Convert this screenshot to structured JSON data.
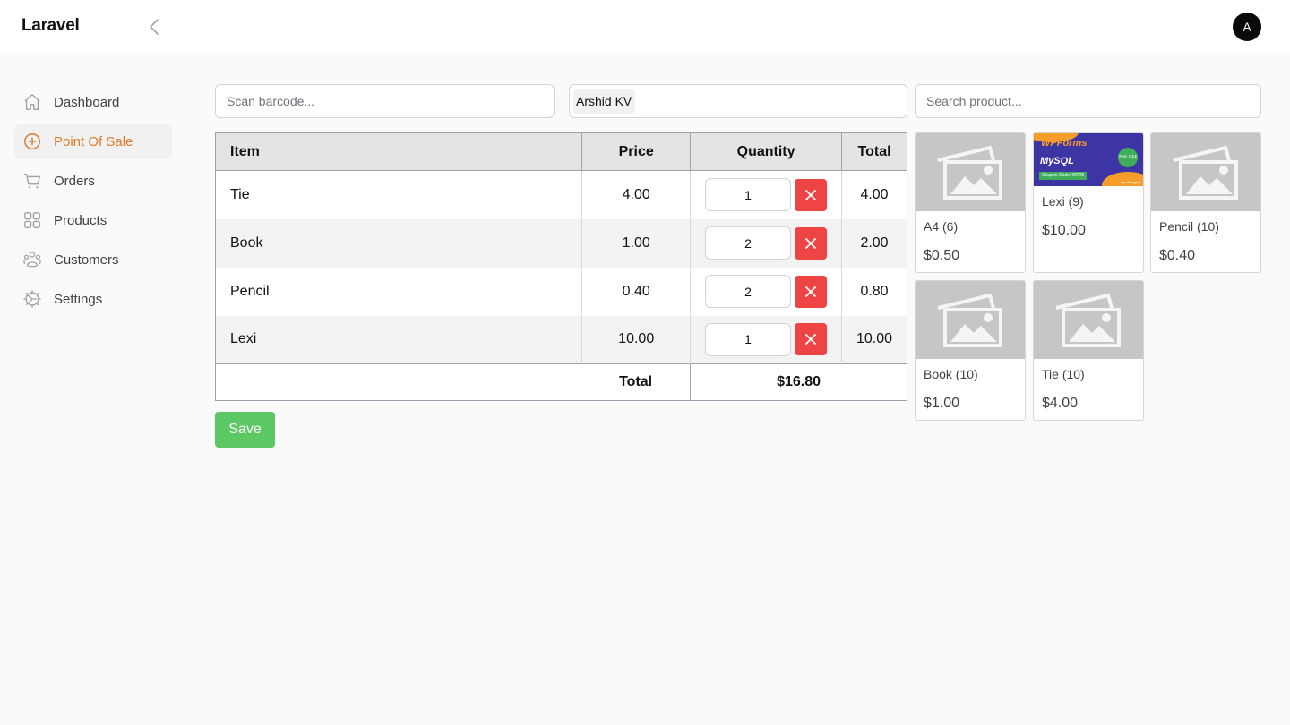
{
  "app": {
    "brand": "Laravel",
    "avatar_initial": "A"
  },
  "sidebar": {
    "items": [
      {
        "label": "Dashboard",
        "icon": "home-icon",
        "active": false
      },
      {
        "label": "Point Of Sale",
        "icon": "plus-circle-icon",
        "active": true
      },
      {
        "label": "Orders",
        "icon": "cart-icon",
        "active": false
      },
      {
        "label": "Products",
        "icon": "grid-icon",
        "active": false
      },
      {
        "label": "Customers",
        "icon": "users-icon",
        "active": false
      },
      {
        "label": "Settings",
        "icon": "gear-icon",
        "active": false
      }
    ]
  },
  "pos": {
    "barcode_placeholder": "Scan barcode...",
    "customer_selected": "Arshid KV",
    "search_placeholder": "Search product...",
    "cart": {
      "headers": {
        "item": "Item",
        "price": "Price",
        "quantity": "Quantity",
        "total": "Total"
      },
      "rows": [
        {
          "item": "Tie",
          "price": "4.00",
          "quantity": "1",
          "total": "4.00"
        },
        {
          "item": "Book",
          "price": "1.00",
          "quantity": "2",
          "total": "2.00"
        },
        {
          "item": "Pencil",
          "price": "0.40",
          "quantity": "2",
          "total": "0.80"
        },
        {
          "item": "Lexi",
          "price": "10.00",
          "quantity": "1",
          "total": "10.00"
        }
      ],
      "footer_label": "Total",
      "footer_value": "$16.80"
    },
    "save_label": "Save",
    "products": [
      {
        "name": "A4 (6)",
        "price": "$0.50",
        "image": "placeholder"
      },
      {
        "name": "Lexi (9)",
        "price": "$10.00",
        "image": "banner"
      },
      {
        "name": "Pencil (10)",
        "price": "$0.40",
        "image": "placeholder"
      },
      {
        "name": "Book (10)",
        "price": "$1.00",
        "image": "placeholder"
      },
      {
        "name": "Tie (10)",
        "price": "$4.00",
        "image": "placeholder"
      }
    ],
    "banner": {
      "title": "WPForms",
      "subtitle": "MySQL",
      "coupon": "Coupon Code: WP25",
      "badge": "25% OFF",
      "site": "wpdebuglog"
    }
  },
  "colors": {
    "accent": "#e07a27",
    "danger": "#ef4444",
    "success": "#5cc863"
  }
}
